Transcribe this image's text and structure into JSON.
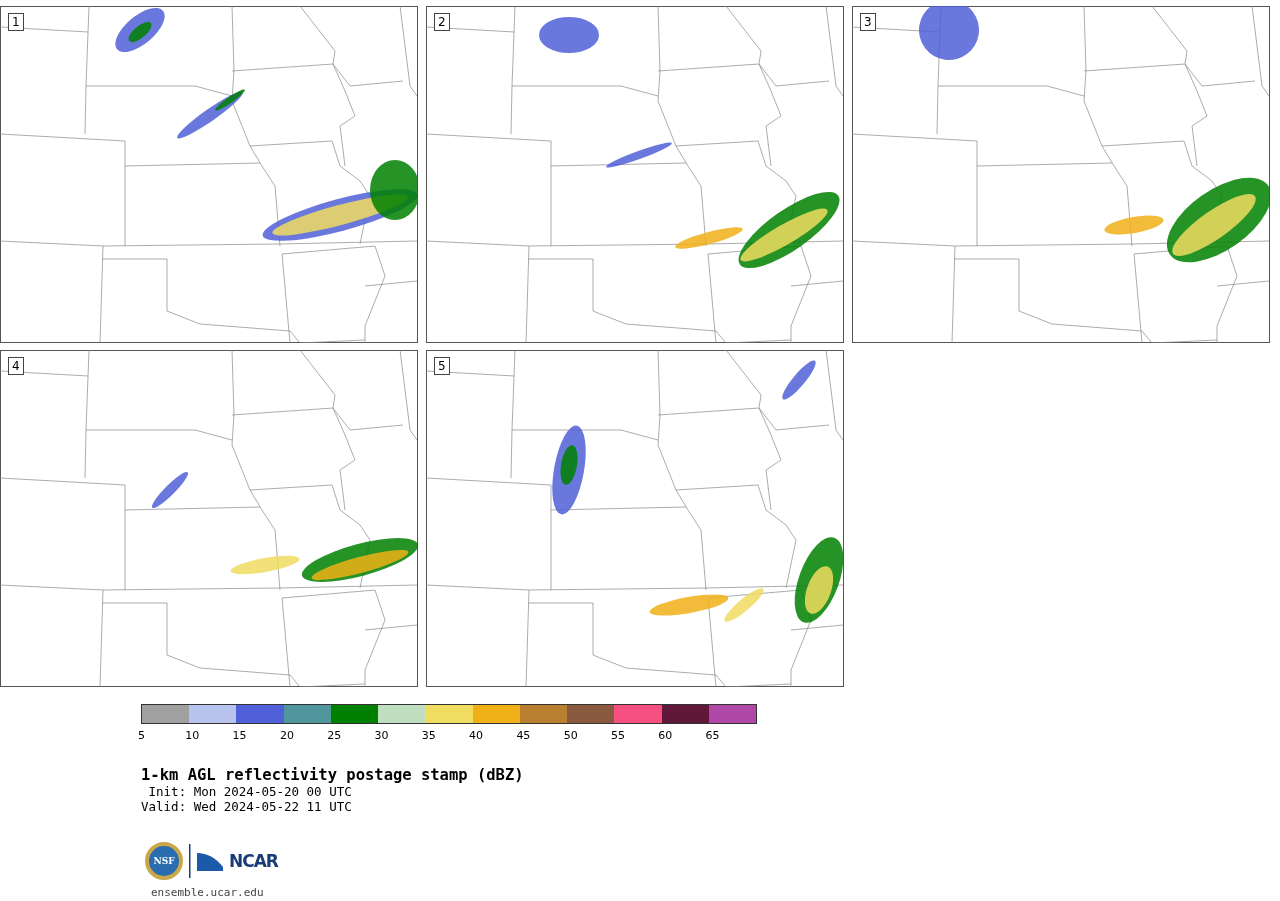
{
  "panels": [
    {
      "label": "1"
    },
    {
      "label": "2"
    },
    {
      "label": "3"
    },
    {
      "label": "4"
    },
    {
      "label": "5"
    }
  ],
  "colorbar": {
    "bins": [
      {
        "color": "#a0a0a0"
      },
      {
        "color": "#b8c4ee"
      },
      {
        "color": "#5060d8"
      },
      {
        "color": "#50969c"
      },
      {
        "color": "#008000"
      },
      {
        "color": "#c0dfc0"
      },
      {
        "color": "#f0dc60"
      },
      {
        "color": "#f0b018"
      },
      {
        "color": "#b88030"
      },
      {
        "color": "#8a5a40"
      },
      {
        "color": "#f55080"
      },
      {
        "color": "#601838"
      },
      {
        "color": "#b048a8"
      }
    ],
    "ticks": [
      "5",
      "10",
      "15",
      "20",
      "25",
      "30",
      "35",
      "40",
      "45",
      "50",
      "55",
      "60",
      "65"
    ]
  },
  "title": "1-km AGL reflectivity postage stamp (dBZ)",
  "init": " Init: Mon 2024-05-20 00 UTC",
  "valid": "Valid: Wed 2024-05-22 11 UTC",
  "logo": {
    "left": "NSF",
    "right": "NCAR"
  },
  "footer": "ensemble.ucar.edu"
}
